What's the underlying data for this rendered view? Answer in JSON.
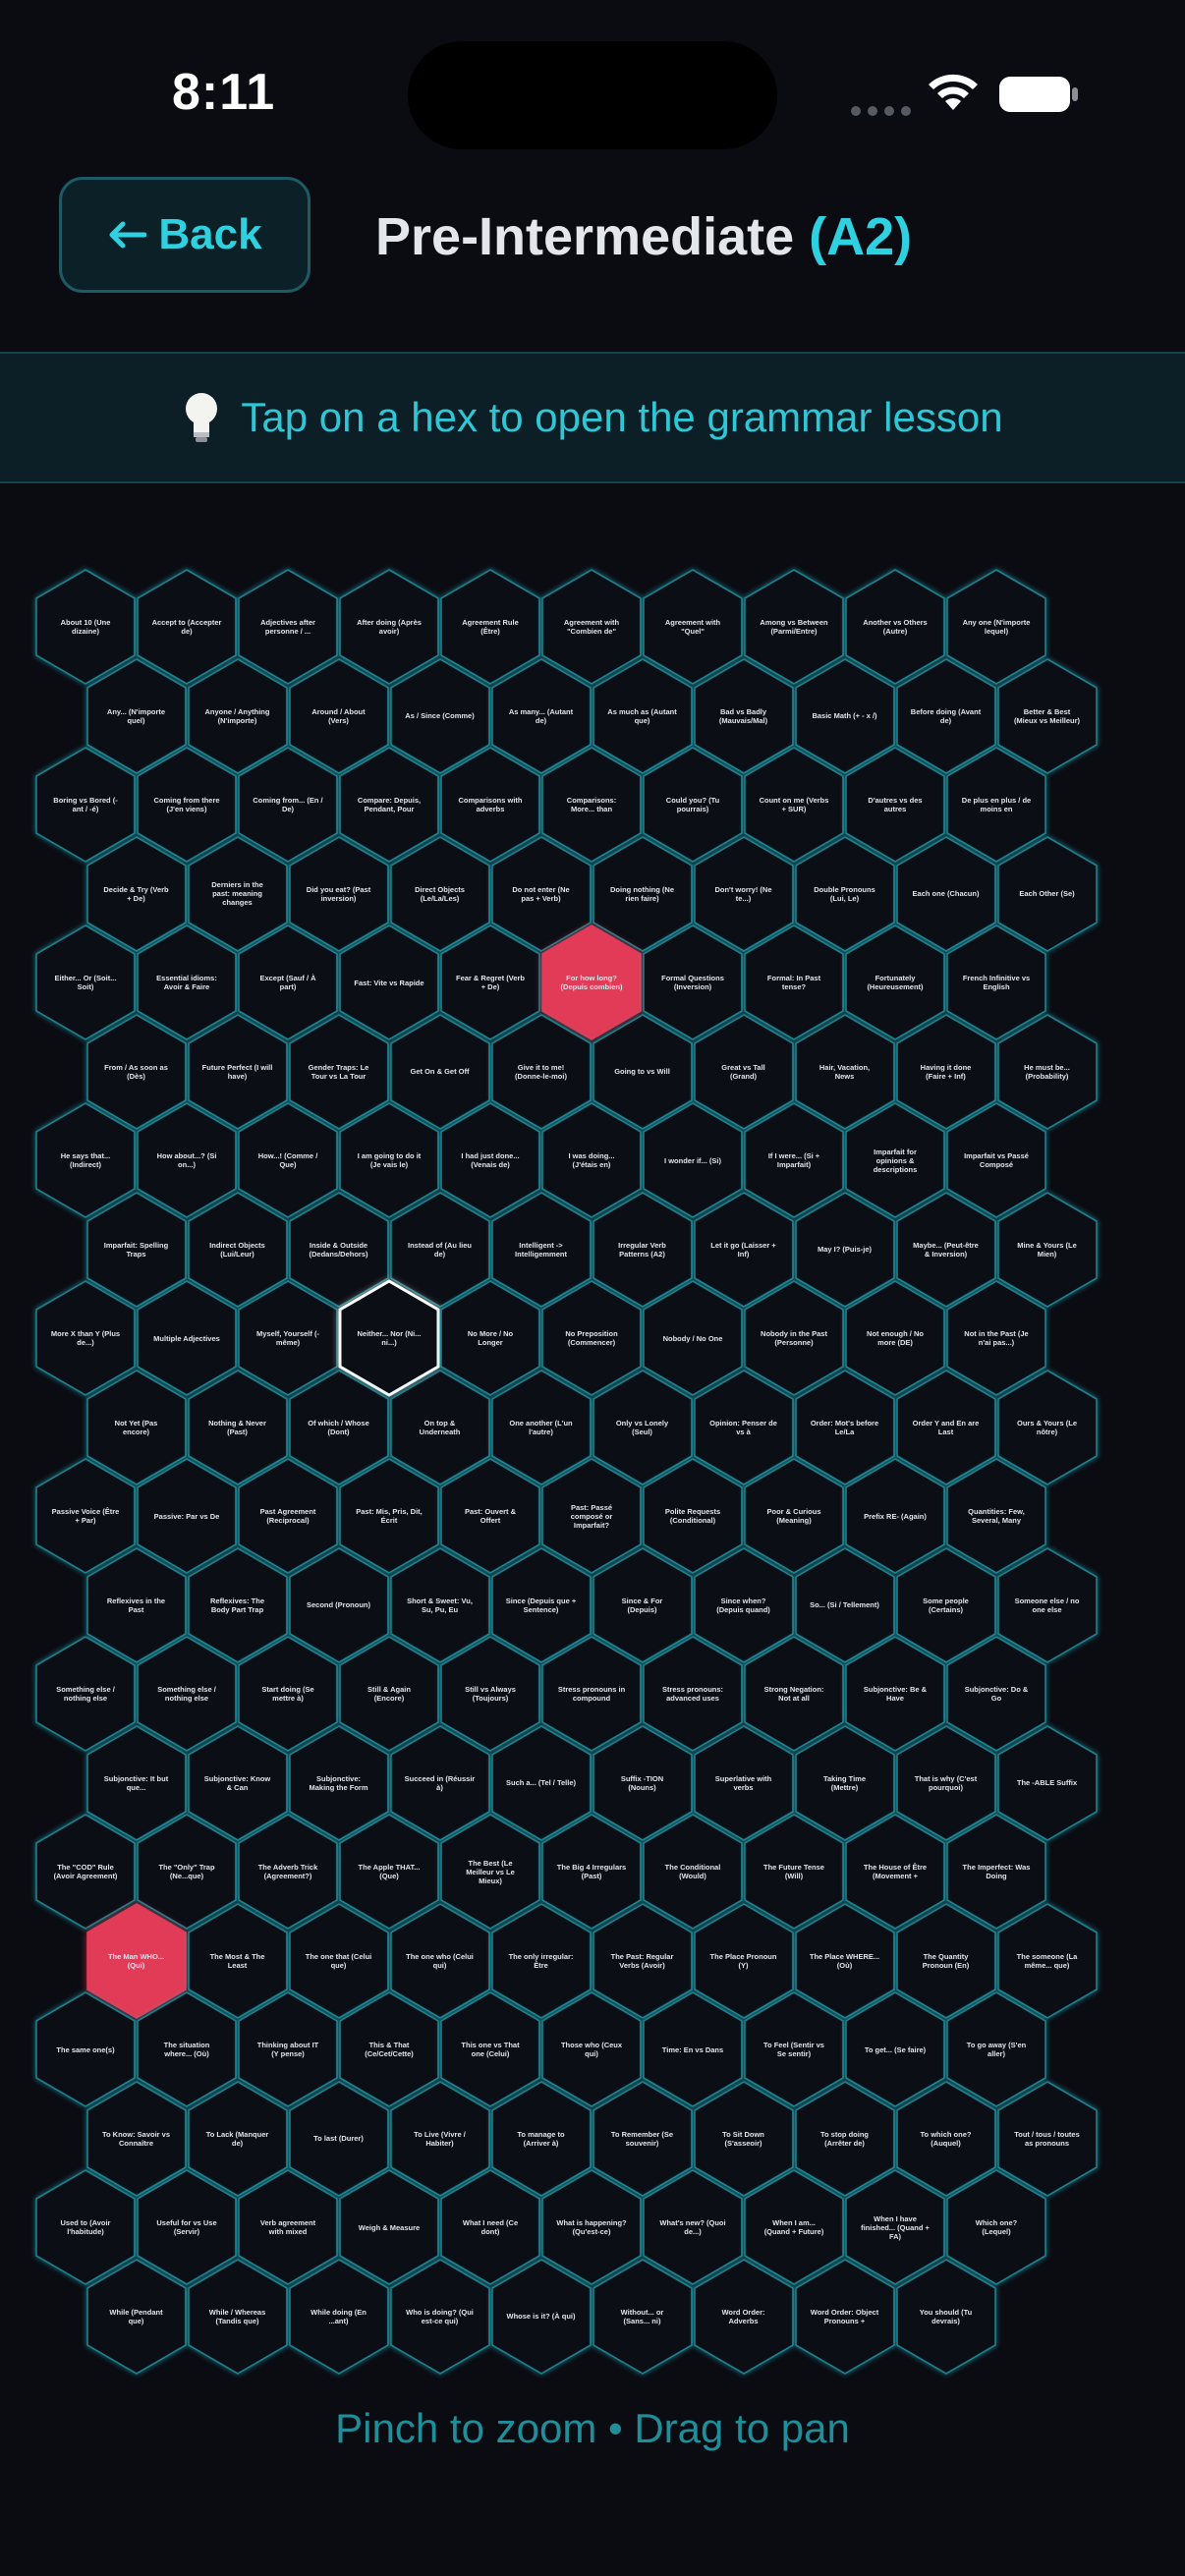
{
  "status_bar": {
    "time": "8:11"
  },
  "header": {
    "back_label": "Back",
    "title_main": "Pre-Intermediate",
    "title_level": "(A2)"
  },
  "hint": {
    "text": "Tap on a hex to open the grammar lesson"
  },
  "footer": {
    "text": "Pinch to zoom • Drag to pan"
  },
  "colors": {
    "accent": "#2fd0df",
    "active_hex": "#e23b57",
    "background": "#0a0c12"
  },
  "hex_rows": [
    [
      "About 10 (Une dizaine)",
      "Accept to (Accepter de)",
      "Adjectives after personne / ...",
      "After doing (Après avoir)",
      "Agreement Rule (Être)",
      "Agreement with \"Combien de\"",
      "Agreement with \"Quel\"",
      "Among vs Between (Parmi/Entre)",
      "Another vs Others (Autre)",
      "Any one (N'importe lequel)"
    ],
    [
      "Any... (N'importe quel)",
      "Anyone / Anything (N'importe)",
      "Around / About (Vers)",
      "As / Since (Comme)",
      "As many... (Autant de)",
      "As much as (Autant que)",
      "Bad vs Badly (Mauvais/Mal)",
      "Basic Math (+ - x /)",
      "Before doing (Avant de)",
      "Better & Best (Mieux vs Meilleur)"
    ],
    [
      "Boring vs Bored (-ant / -é)",
      "Coming from there (J'en viens)",
      "Coming from... (En / De)",
      "Compare: Depuis, Pendant, Pour",
      "Comparisons with adverbs",
      "Comparisons: More... than",
      "Could you? (Tu pourrais)",
      "Count on me (Verbs + SUR)",
      "D'autres vs des autres",
      "De plus en plus / de moins en"
    ],
    [
      "Decide & Try (Verb + De)",
      "Derniers in the past: meaning changes",
      "Did you eat? (Past inversion)",
      "Direct Objects (Le/La/Les)",
      "Do not enter (Ne pas + Verb)",
      "Doing nothing (Ne rien faire)",
      "Don't worry! (Ne te...)",
      "Double Pronouns (Lui, Le)",
      "Each one (Chacun)",
      "Each Other (Se)"
    ],
    [
      "Either... Or (Soit... Soit)",
      "Essential idioms: Avoir & Faire",
      "Except (Sauf / À part)",
      "Fast: Vite vs Rapide",
      "Fear & Regret (Verb + De)",
      "For how long? (Depuis combien)",
      "Formal Questions (Inversion)",
      "Formal: In Past tense?",
      "Fortunately (Heureusement)",
      "French Infinitive vs English"
    ],
    [
      "From / As soon as (Dès)",
      "Future Perfect (I will have)",
      "Gender Traps: Le Tour vs La Tour",
      "Get On & Get Off",
      "Give it to me! (Donne-le-moi)",
      "Going to vs Will",
      "Great vs Tall (Grand)",
      "Hair, Vacation, News",
      "Having it done (Faire + Inf)",
      "He must be... (Probability)"
    ],
    [
      "He says that... (Indirect)",
      "How about...? (Si on...)",
      "How...! (Comme / Que)",
      "I am going to do it (Je vais le)",
      "I had just done... (Venais de)",
      "I was doing... (J'étais en)",
      "I wonder if... (Si)",
      "If I were... (Si + Imparfait)",
      "Imparfait for opinions & descriptions",
      "Imparfait vs Passé Composé"
    ],
    [
      "Imparfait: Spelling Traps",
      "Indirect Objects (Lui/Leur)",
      "Inside & Outside (Dedans/Dehors)",
      "Instead of (Au lieu de)",
      "Intelligent -> Intelligemment",
      "Irregular Verb Patterns (A2)",
      "Let it go (Laisser + Inf)",
      "May I? (Puis-je)",
      "Maybe... (Peut-être & Inversion)",
      "Mine & Yours (Le Mien)"
    ],
    [
      "More X than Y (Plus de...)",
      "Multiple Adjectives",
      "Myself, Yourself (-même)",
      "Neither... Nor (Ni... ni...)",
      "No More / No Longer",
      "No Preposition (Commencer)",
      "Nobody / No One",
      "Nobody in the Past (Personne)",
      "Not enough / No more (DE)",
      "Not in the Past (Je n'ai pas...)"
    ],
    [
      "Not Yet (Pas encore)",
      "Nothing & Never (Past)",
      "Of which / Whose (Dont)",
      "On top & Underneath",
      "One another (L'un l'autre)",
      "Only vs Lonely (Seul)",
      "Opinion: Penser de vs à",
      "Order: Mot's before Le/La",
      "Order Y and En are Last",
      "Ours & Yours (Le nôtre)"
    ],
    [
      "Passive Voice (Être + Par)",
      "Passive: Par vs De",
      "Past Agreement (Reciprocal)",
      "Past: Mis, Pris, Dit, Écrit",
      "Past: Ouvert & Offert",
      "Past: Passé composé or Imparfait?",
      "Polite Requests (Conditional)",
      "Poor & Curious (Meaning)",
      "Prefix RE- (Again)",
      "Quantities: Few, Several, Many"
    ],
    [
      "Reflexives in the Past",
      "Reflexives: The Body Part Trap",
      "Second (Pronoun)",
      "Short & Sweet: Vu, Su, Pu, Eu",
      "Since (Depuis que + Sentence)",
      "Since & For (Depuis)",
      "Since when? (Depuis quand)",
      "So... (Si / Tellement)",
      "Some people (Certains)",
      "Someone else / no one else"
    ],
    [
      "Something else / nothing else",
      "Something else / nothing else",
      "Start doing (Se mettre à)",
      "Still & Again (Encore)",
      "Still vs Always (Toujours)",
      "Stress pronouns in compound",
      "Stress pronouns: advanced uses",
      "Strong Negation: Not at all",
      "Subjonctive: Be & Have",
      "Subjonctive: Do & Go"
    ],
    [
      "Subjonctive: It but que...",
      "Subjonctive: Know & Can",
      "Subjonctive: Making the Form",
      "Succeed in (Réussir à)",
      "Such a... (Tel / Telle)",
      "Suffix -TION (Nouns)",
      "Superlative with verbs",
      "Taking Time (Mettre)",
      "That is why (C'est pourquoi)",
      "The -ABLE Suffix"
    ],
    [
      "The \"COD\" Rule (Avoir Agreement)",
      "The \"Only\" Trap (Ne...que)",
      "The Adverb Trick (Agreement?)",
      "The Apple THAT... (Que)",
      "The Best (Le Meilleur vs Le Mieux)",
      "The Big 4 Irregulars (Past)",
      "The Conditional (Would)",
      "The Future Tense (Will)",
      "The House of Être (Movement +",
      "The Imperfect: Was Doing"
    ],
    [
      "The Man WHO... (Qui)",
      "The Most & The Least",
      "The one that (Celui que)",
      "The one who (Celui qui)",
      "The only irregular: Être",
      "The Past: Regular Verbs (Avoir)",
      "The Place Pronoun (Y)",
      "The Place WHERE... (Où)",
      "The Quantity Pronoun (En)",
      "The someone (La même... que)"
    ],
    [
      "The same one(s)",
      "The situation where... (Où)",
      "Thinking about IT (Y pense)",
      "This & That (Ce/Cet/Cette)",
      "This one vs That one (Celui)",
      "Those who (Ceux qui)",
      "Time: En vs Dans",
      "To Feel (Sentir vs Se sentir)",
      "To get... (Se faire)",
      "To go away (S'en aller)"
    ],
    [
      "To Know: Savoir vs Connaître",
      "To Lack (Manquer de)",
      "To last (Durer)",
      "To Live (Vivre / Habiter)",
      "To manage to (Arriver à)",
      "To Remember (Se souvenir)",
      "To Sit Down (S'asseoir)",
      "To stop doing (Arrêter de)",
      "To which one? (Auquel)",
      "Tout / tous / toutes as pronouns"
    ],
    [
      "Used to (Avoir l'habitude)",
      "Useful for vs Use (Servir)",
      "Verb agreement with mixed",
      "Weigh & Measure",
      "What I need (Ce dont)",
      "What is happening? (Qu'est-ce)",
      "What's new? (Quoi de...)",
      "When I am... (Quand + Future)",
      "When I have finished... (Quand + FA)",
      "Which one? (Lequel)"
    ],
    [
      "While (Pendant que)",
      "While / Whereas (Tandis que)",
      "While doing (En ...ant)",
      "Who is doing? (Qui est-ce qui)",
      "Whose is it? (À qui)",
      "Without... or (Sans... ni)",
      "Word Order: Adverbs",
      "Word Order: Object Pronouns +",
      "You should (Tu devrais)"
    ]
  ],
  "active_hexes": [
    "For how long? (Depuis combien)",
    "The Man WHO... (Qui)"
  ],
  "selected_hex": "Neither... Nor (Ni... ni...)"
}
